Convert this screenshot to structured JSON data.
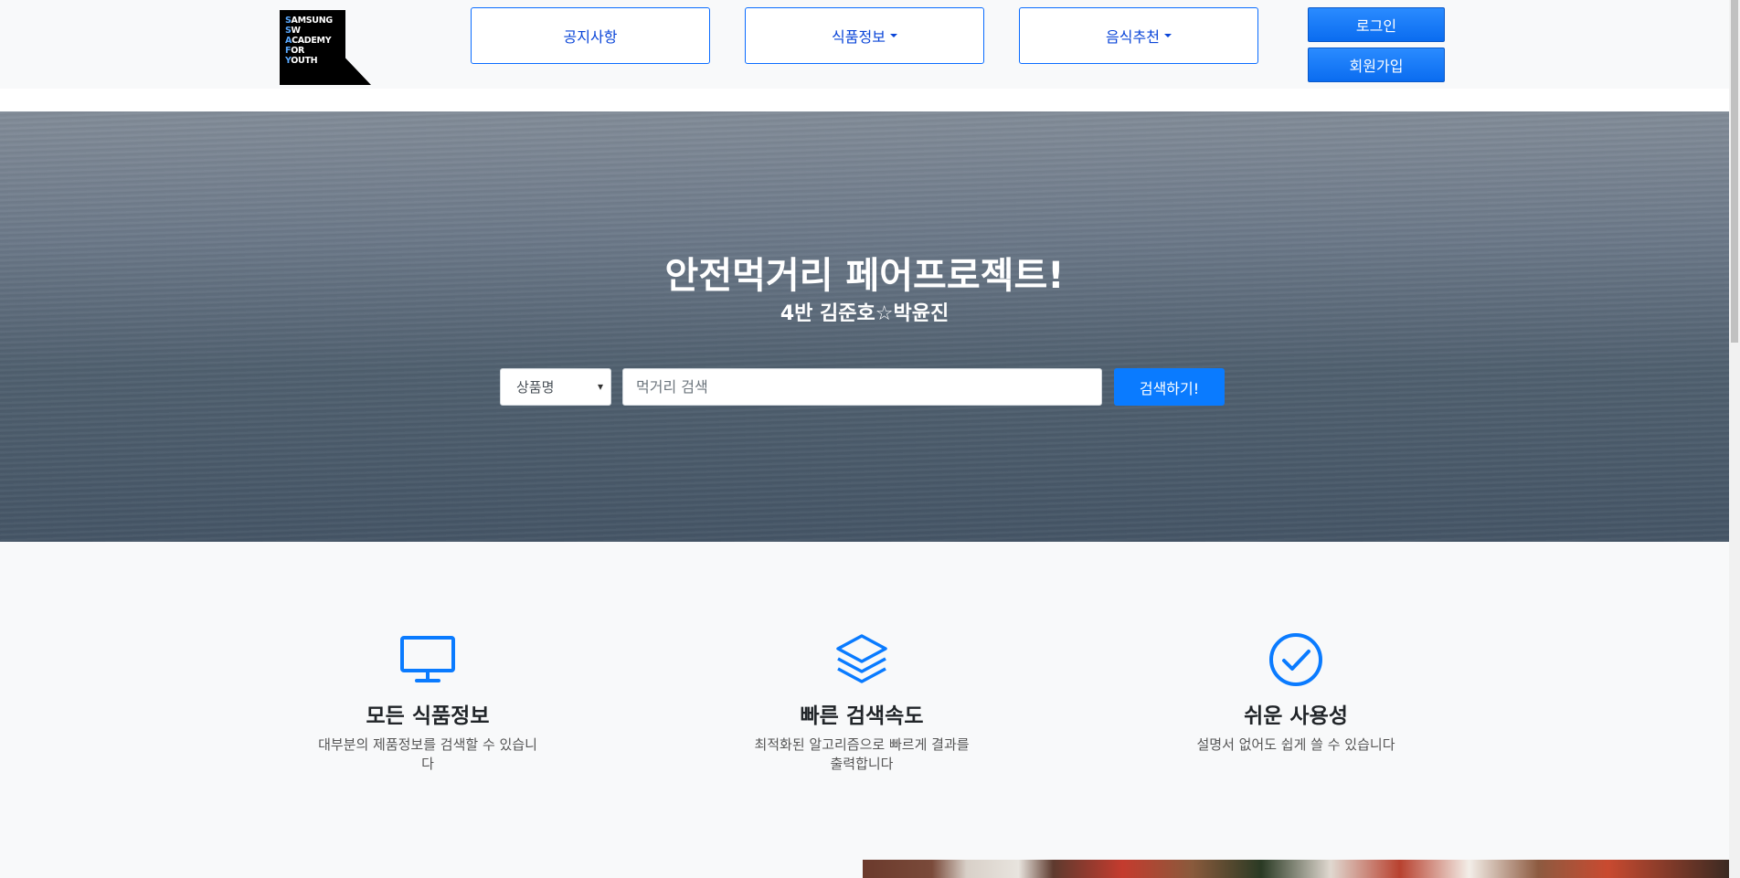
{
  "header": {
    "logo_lines": [
      "SAMSUNG",
      "SW",
      "ACADEMY",
      "FOR",
      "YOUTH"
    ],
    "nav": [
      {
        "label": "공지사항",
        "dropdown": false
      },
      {
        "label": "식품정보",
        "dropdown": true
      },
      {
        "label": "음식추천",
        "dropdown": true
      }
    ],
    "auth": {
      "login_label": "로그인",
      "signup_label": "회원가입"
    }
  },
  "hero": {
    "title": "안전먹거리 페어프로젝트!",
    "subtitle": "4반 김준호☆박윤진",
    "search": {
      "select_value": "상품명",
      "input_value": "",
      "input_placeholder": "먹거리 검색",
      "button_label": "검색하기!"
    }
  },
  "features": [
    {
      "icon": "monitor-icon",
      "title": "모든 식품정보",
      "desc": "대부분의 제품정보를 검색할 수 있습니다"
    },
    {
      "icon": "layers-icon",
      "title": "빠른 검색속도",
      "desc": "최적화된 알고리즘으로 빠르게 결과를 출력합니다"
    },
    {
      "icon": "check-circle-icon",
      "title": "쉬운 사용성",
      "desc": "설명서 없어도 쉽게 쓸 수 있습니다"
    }
  ],
  "colors": {
    "accent": "#0a7bff",
    "nav_text": "#0a45d8",
    "page_bg": "#f8f9fa"
  }
}
